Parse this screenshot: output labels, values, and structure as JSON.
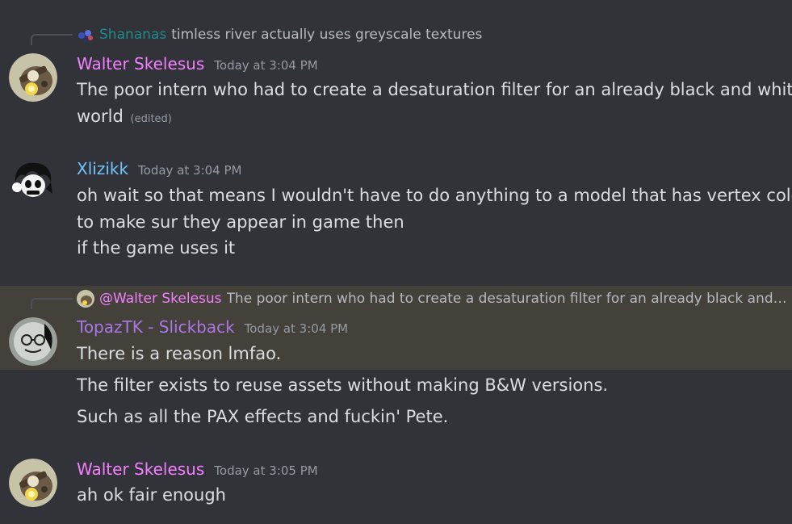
{
  "colors": {
    "background": "#313338",
    "highlight": "#44403a",
    "walter": "#f47fff",
    "xlizikk": "#6ec4ff",
    "topaz": "#a977e8",
    "shananas": "#1f8b8b",
    "muted": "#949ba4"
  },
  "messages": [
    {
      "reply": {
        "author": "Shananas",
        "text": "timless river actually uses greyscale textures"
      },
      "author": "Walter Skelesus",
      "timestamp": "Today at 3:04 PM",
      "lines": [
        "The poor intern who had to create a desaturation filter for an already black and white",
        "world"
      ],
      "edited_label": "(edited)"
    },
    {
      "author": "Xlizikk",
      "timestamp": "Today at 3:04 PM",
      "lines": [
        "oh wait so that means I wouldn't have to do anything to a model that has vertex colors",
        "to make sur they appear in game then",
        "if the game uses it"
      ]
    },
    {
      "reply": {
        "author": "@Walter Skelesus",
        "text": "The poor intern who had to create a desaturation filter for an already black and white world"
      },
      "author": "TopazTK - Slickback",
      "timestamp": "Today at 3:04 PM",
      "lines": [
        "There is a reason lmfao.",
        "The filter exists to reuse assets without making B&W versions.",
        "Such as all the PAX effects and fuckin' Pete."
      ]
    },
    {
      "author": "Walter Skelesus",
      "timestamp": "Today at 3:05 PM",
      "lines": [
        "ah ok fair enough"
      ]
    }
  ]
}
